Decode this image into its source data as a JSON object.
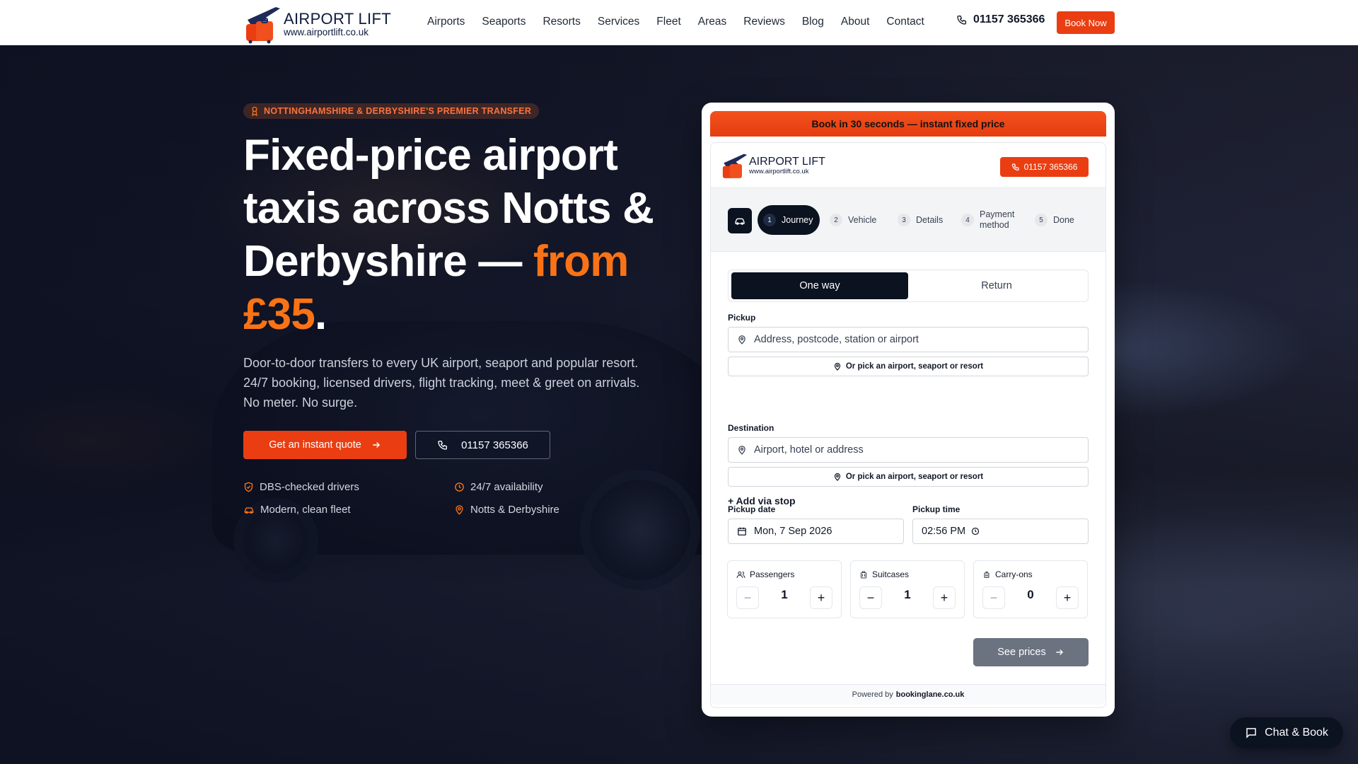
{
  "brand": {
    "name": "AIRPORT LIFT",
    "url": "www.airportlift.co.uk"
  },
  "nav": {
    "links": [
      "Airports",
      "Seaports",
      "Resorts",
      "Services",
      "Fleet",
      "Areas",
      "Reviews",
      "Blog",
      "About",
      "Contact"
    ],
    "phone": "01157 365366",
    "book_label": "Book Now"
  },
  "hero": {
    "badge": "NOTTINGHAMSHIRE & DERBYSHIRE'S PREMIER TRANSFER",
    "title_main": "Fixed-price airport taxis across Notts & Derbyshire — ",
    "title_accent": "from £35",
    "title_end": ".",
    "lead": "Door-to-door transfers to every UK airport, seaport and popular resort. 24/7 booking, licensed drivers, flight tracking, meet & greet on arrivals. No meter. No surge.",
    "quote_button": "Get an instant quote",
    "call_button": "01157 365366",
    "features": [
      "DBS-checked drivers",
      "24/7 availability",
      "Modern, clean fleet",
      "Notts & Derbyshire"
    ]
  },
  "booking": {
    "banner": "Book in 30 seconds — instant fixed price",
    "brand_name": "AIRPORT LIFT",
    "brand_url": "www.airportlift.co.uk",
    "phone": "01157 365366",
    "steps": [
      {
        "num": "1",
        "label": "Journey"
      },
      {
        "num": "2",
        "label": "Vehicle"
      },
      {
        "num": "3",
        "label": "Details"
      },
      {
        "num": "4",
        "label": "Payment method"
      },
      {
        "num": "5",
        "label": "Done"
      }
    ],
    "active_step": 1,
    "trip_types": [
      "One way",
      "Return"
    ],
    "selected_trip": "One way",
    "pickup_label": "Pickup",
    "pickup_placeholder": "Address, postcode, station or airport",
    "pick_place_label": "Or pick an airport, seaport or resort",
    "add_via": "+ Add via stop",
    "destination_label": "Destination",
    "destination_placeholder": "Airport, hotel or address",
    "date_label": "Pickup date",
    "date_value": "Mon, 7 Sep 2026",
    "time_label": "Pickup time",
    "time_value": "02:56 PM",
    "counters": [
      {
        "label": "Passengers",
        "value": "1"
      },
      {
        "label": "Suitcases",
        "value": "1"
      },
      {
        "label": "Carry-ons",
        "value": "0"
      }
    ],
    "submit": "See prices",
    "powered_prefix": "Powered by",
    "powered_brand": "bookinglane.co.uk"
  },
  "chat": {
    "label": "Chat & Book"
  },
  "colors": {
    "accent": "#ea3e12",
    "accent_text": "#f97316",
    "dark": "#0b1220"
  }
}
